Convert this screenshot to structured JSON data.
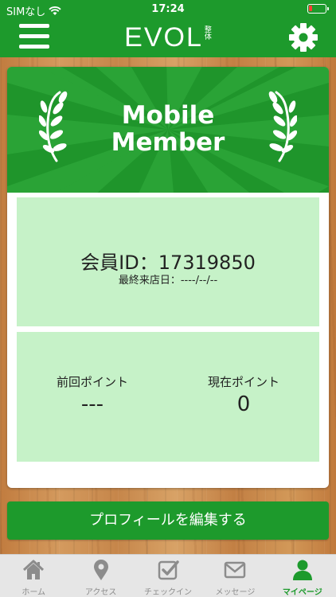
{
  "status_bar": {
    "carrier": "SIMなし",
    "time": "17:24"
  },
  "header": {
    "logo_text": "EVOL",
    "logo_sub": "整体"
  },
  "banner": {
    "title_line1": "Mobile",
    "title_line2": "Member"
  },
  "member": {
    "id_line": "会員ID：17319850",
    "last_visit": "最終来店日：----/--/--"
  },
  "points": {
    "previous_label": "前回ポイント",
    "previous_value": "---",
    "current_label": "現在ポイント",
    "current_value": "0"
  },
  "profile_button": "プロフィールを編集する",
  "tabs": [
    {
      "label": "ホーム",
      "icon": "home-icon"
    },
    {
      "label": "アクセス",
      "icon": "map-pin-icon"
    },
    {
      "label": "チェックイン",
      "icon": "checkin-icon"
    },
    {
      "label": "メッセージ",
      "icon": "envelope-icon"
    },
    {
      "label": "マイページ",
      "icon": "person-icon",
      "active": true
    }
  ],
  "colors": {
    "brand_green": "#1d9a2c",
    "panel_green": "#c6f2c8",
    "tab_inactive": "#8c8c8c"
  }
}
